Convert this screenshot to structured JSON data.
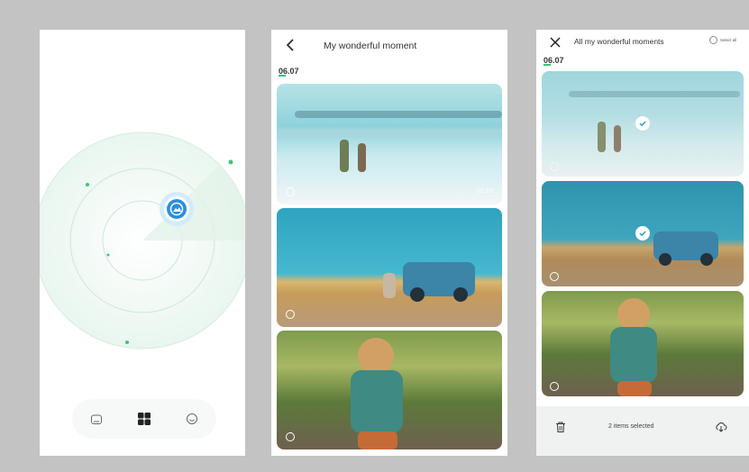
{
  "screen_player": {
    "nav": {
      "home_icon": "home-icon",
      "grid_icon": "grid-icon",
      "profile_icon": "smiley-icon"
    },
    "colors": {
      "accent": "#2a8fe0",
      "radar": "#3cc47a"
    }
  },
  "screen_album": {
    "title": "My wonderful moment",
    "date": "06.07",
    "photos": [
      {
        "duration": "01:23"
      },
      {
        "duration": ""
      },
      {
        "duration": ""
      }
    ]
  },
  "screen_select": {
    "title": "All my wonderful moments",
    "select_all_label": "Select all",
    "date": "06.07",
    "selected_text": "2 items selected"
  }
}
